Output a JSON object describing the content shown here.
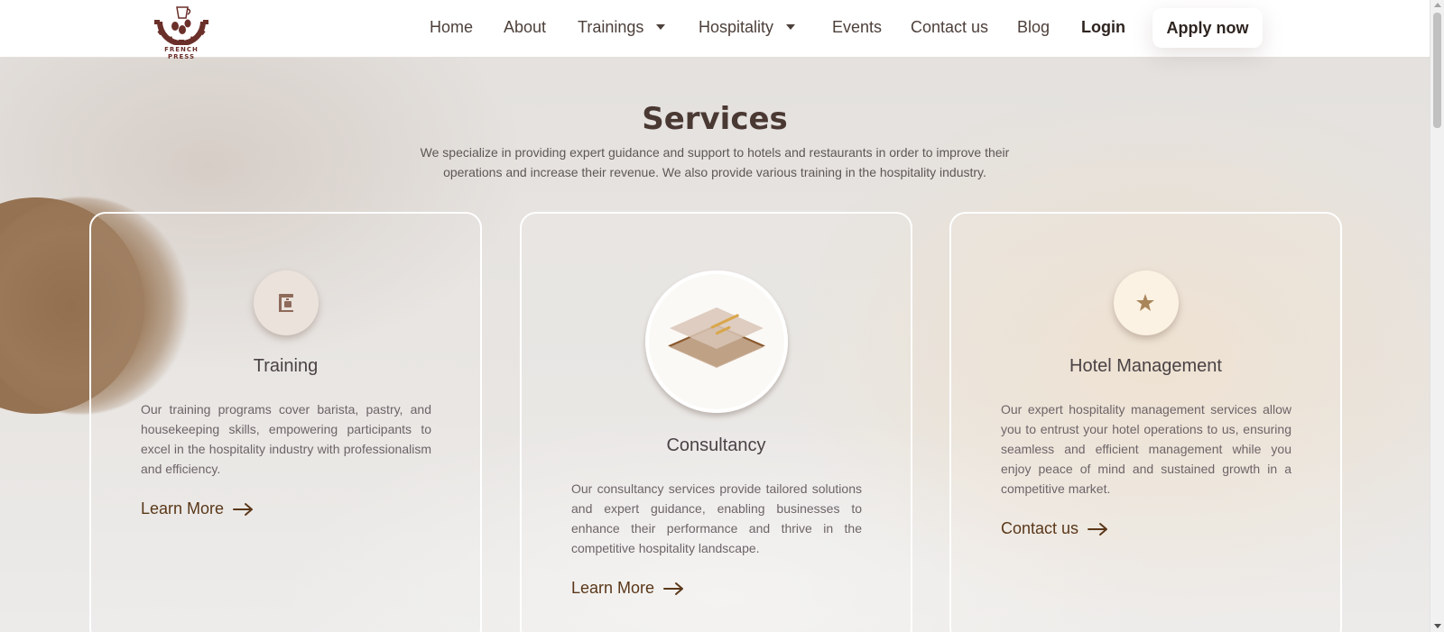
{
  "brand": {
    "logo_text": "FRENCH PRESS"
  },
  "nav": {
    "items": [
      {
        "label": "Home"
      },
      {
        "label": "About"
      },
      {
        "label": "Trainings",
        "dropdown": true
      },
      {
        "label": "Hospitality",
        "dropdown": true
      },
      {
        "label": "Events"
      },
      {
        "label": "Contact us"
      },
      {
        "label": "Blog"
      }
    ],
    "login_label": "Login",
    "apply_label": "Apply now"
  },
  "services": {
    "title": "Services",
    "description": "We specialize in providing expert guidance and support to hotels and restaurants in order to improve their operations and increase their revenue. We also provide various training in the hospitality industry.",
    "cards": [
      {
        "icon": "coffee-machine-icon",
        "title": "Training",
        "text": "Our training programs cover barista, pastry, and housekeeping skills, empowering participants to excel in the hospitality industry with professionalism and efficiency.",
        "link_label": "Learn More"
      },
      {
        "icon": "layers-icon",
        "title": "Consultancy",
        "text": "Our consultancy services provide tailored solutions and expert guidance, enabling businesses to enhance their performance and thrive in the competitive hospitality landscape.",
        "link_label": "Learn More"
      },
      {
        "icon": "star-icon",
        "title": "Hotel Management",
        "text": "Our expert hospitality management services allow you to entrust your hotel operations to us, ensuring seamless and efficient management while you enjoy peace of mind and sustained growth in a competitive market.",
        "link_label": "Contact us"
      }
    ]
  },
  "colors": {
    "accent_brown": "#5a3719",
    "blob_brown": "#957252",
    "logo_maroon": "#6b2f2a"
  }
}
